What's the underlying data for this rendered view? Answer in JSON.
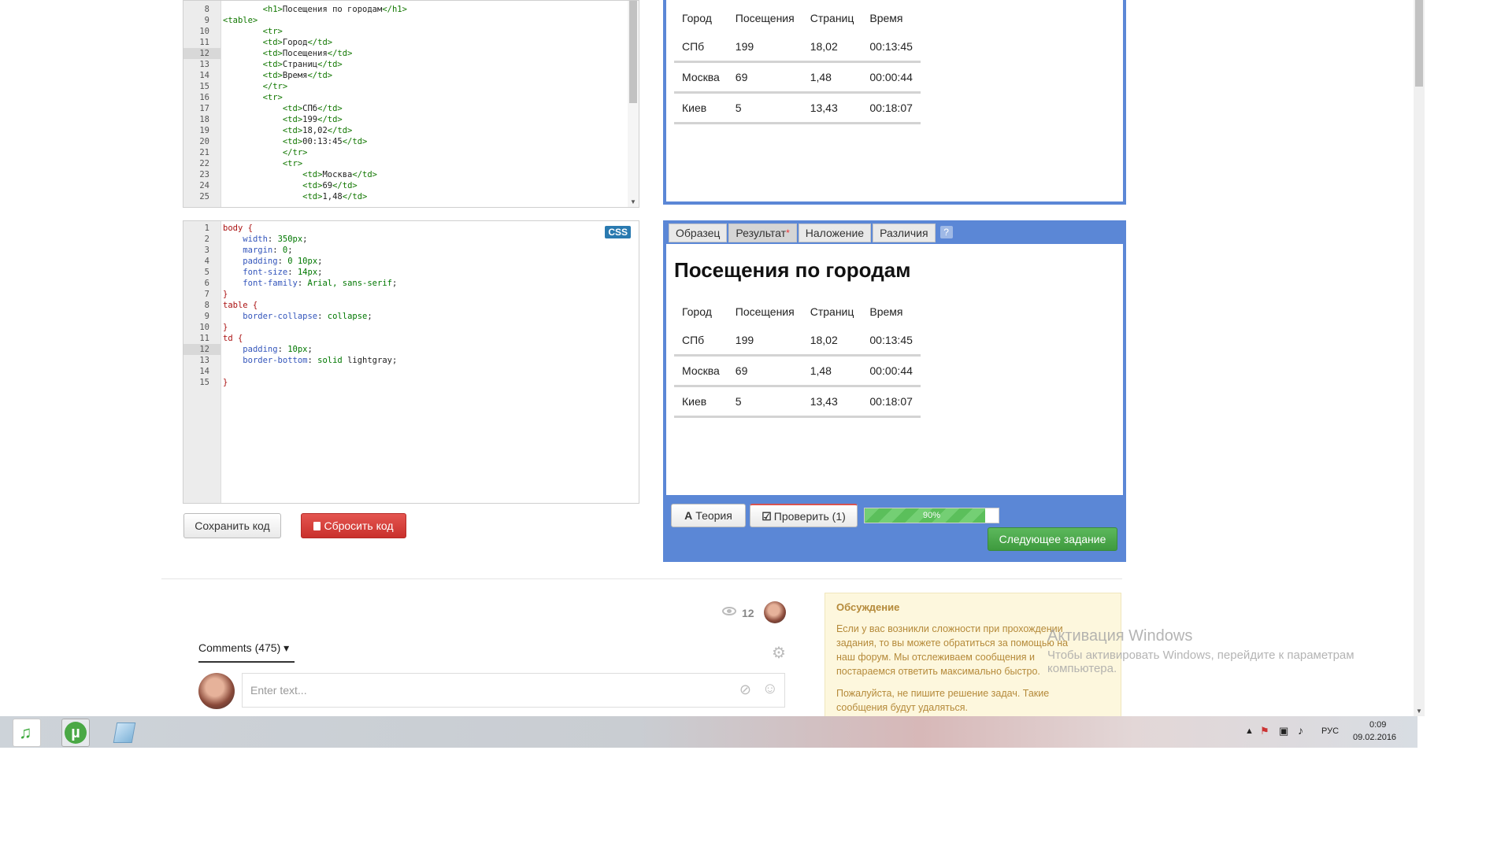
{
  "html_editor": {
    "lines": [
      {
        "n": "8",
        "parts": [
          [
            "pl",
            "        "
          ],
          [
            "tag",
            "<h1>"
          ],
          [
            "pl",
            "Посещения по городам"
          ],
          [
            "tag",
            "</h1>"
          ]
        ]
      },
      {
        "n": "9",
        "parts": [
          [
            "tag",
            "<table>"
          ]
        ]
      },
      {
        "n": "10",
        "parts": [
          [
            "pl",
            "        "
          ],
          [
            "tag",
            "<tr>"
          ]
        ]
      },
      {
        "n": "11",
        "parts": [
          [
            "pl",
            "        "
          ],
          [
            "tag",
            "<td>"
          ],
          [
            "pl",
            "Город"
          ],
          [
            "tag",
            "</td>"
          ]
        ]
      },
      {
        "n": "12",
        "parts": [
          [
            "pl",
            "        "
          ],
          [
            "tag",
            "<td>"
          ],
          [
            "pl",
            "Посещения"
          ],
          [
            "tag",
            "</td>"
          ]
        ],
        "active": true
      },
      {
        "n": "13",
        "parts": [
          [
            "pl",
            "        "
          ],
          [
            "tag",
            "<td>"
          ],
          [
            "pl",
            "Страниц"
          ],
          [
            "tag",
            "</td>"
          ]
        ]
      },
      {
        "n": "14",
        "parts": [
          [
            "pl",
            "        "
          ],
          [
            "tag",
            "<td>"
          ],
          [
            "pl",
            "Время"
          ],
          [
            "tag",
            "</td>"
          ]
        ]
      },
      {
        "n": "15",
        "parts": [
          [
            "pl",
            "        "
          ],
          [
            "tag",
            "</tr>"
          ]
        ]
      },
      {
        "n": "16",
        "parts": [
          [
            "pl",
            "        "
          ],
          [
            "tag",
            "<tr>"
          ]
        ]
      },
      {
        "n": "17",
        "parts": [
          [
            "pl",
            "            "
          ],
          [
            "tag",
            "<td>"
          ],
          [
            "pl",
            "СПб"
          ],
          [
            "tag",
            "</td>"
          ]
        ]
      },
      {
        "n": "18",
        "parts": [
          [
            "pl",
            "            "
          ],
          [
            "tag",
            "<td>"
          ],
          [
            "pl",
            "199"
          ],
          [
            "tag",
            "</td>"
          ]
        ]
      },
      {
        "n": "19",
        "parts": [
          [
            "pl",
            "            "
          ],
          [
            "tag",
            "<td>"
          ],
          [
            "pl",
            "18,02"
          ],
          [
            "tag",
            "</td>"
          ]
        ]
      },
      {
        "n": "20",
        "parts": [
          [
            "pl",
            "            "
          ],
          [
            "tag",
            "<td>"
          ],
          [
            "pl",
            "00:13:45"
          ],
          [
            "tag",
            "</td>"
          ]
        ]
      },
      {
        "n": "21",
        "parts": [
          [
            "pl",
            "            "
          ],
          [
            "tag",
            "</tr>"
          ]
        ]
      },
      {
        "n": "22",
        "parts": [
          [
            "pl",
            "            "
          ],
          [
            "tag",
            "<tr>"
          ]
        ]
      },
      {
        "n": "23",
        "parts": [
          [
            "pl",
            "                "
          ],
          [
            "tag",
            "<td>"
          ],
          [
            "pl",
            "Москва"
          ],
          [
            "tag",
            "</td>"
          ]
        ]
      },
      {
        "n": "24",
        "parts": [
          [
            "pl",
            "                "
          ],
          [
            "tag",
            "<td>"
          ],
          [
            "pl",
            "69"
          ],
          [
            "tag",
            "</td>"
          ]
        ]
      },
      {
        "n": "25",
        "parts": [
          [
            "pl",
            "                "
          ],
          [
            "tag",
            "<td>"
          ],
          [
            "pl",
            "1,48"
          ],
          [
            "tag",
            "</td>"
          ]
        ]
      }
    ]
  },
  "css_editor": {
    "badge": "CSS",
    "lines": [
      {
        "n": "1",
        "parts": [
          [
            "sel",
            "body {"
          ]
        ]
      },
      {
        "n": "2",
        "parts": [
          [
            "pl",
            "    "
          ],
          [
            "prop",
            "width"
          ],
          [
            "pl",
            ": "
          ],
          [
            "val",
            "350px"
          ],
          [
            "pl",
            ";"
          ]
        ]
      },
      {
        "n": "3",
        "parts": [
          [
            "pl",
            "    "
          ],
          [
            "prop",
            "margin"
          ],
          [
            "pl",
            ": "
          ],
          [
            "val",
            "0"
          ],
          [
            "pl",
            ";"
          ]
        ]
      },
      {
        "n": "4",
        "parts": [
          [
            "pl",
            "    "
          ],
          [
            "prop",
            "padding"
          ],
          [
            "pl",
            ": "
          ],
          [
            "val",
            "0 10px"
          ],
          [
            "pl",
            ";"
          ]
        ]
      },
      {
        "n": "5",
        "parts": [
          [
            "pl",
            "    "
          ],
          [
            "prop",
            "font-size"
          ],
          [
            "pl",
            ": "
          ],
          [
            "val",
            "14px"
          ],
          [
            "pl",
            ";"
          ]
        ]
      },
      {
        "n": "6",
        "parts": [
          [
            "pl",
            "    "
          ],
          [
            "prop",
            "font-family"
          ],
          [
            "pl",
            ": "
          ],
          [
            "val",
            "Arial, sans-serif"
          ],
          [
            "pl",
            ";"
          ]
        ]
      },
      {
        "n": "7",
        "parts": [
          [
            "sel",
            "}"
          ]
        ]
      },
      {
        "n": "8",
        "parts": [
          [
            "sel",
            "table {"
          ]
        ]
      },
      {
        "n": "9",
        "parts": [
          [
            "pl",
            "    "
          ],
          [
            "prop",
            "border-collapse"
          ],
          [
            "pl",
            ": "
          ],
          [
            "val",
            "collapse"
          ],
          [
            "pl",
            ";"
          ]
        ]
      },
      {
        "n": "10",
        "parts": [
          [
            "sel",
            "}"
          ]
        ]
      },
      {
        "n": "11",
        "parts": [
          [
            "sel",
            "td {"
          ]
        ]
      },
      {
        "n": "12",
        "parts": [
          [
            "pl",
            "    "
          ],
          [
            "prop",
            "padding"
          ],
          [
            "pl",
            ": "
          ],
          [
            "val",
            "10px"
          ],
          [
            "pl",
            ";"
          ]
        ],
        "active": true
      },
      {
        "n": "13",
        "parts": [
          [
            "pl",
            "    "
          ],
          [
            "prop",
            "border-bottom"
          ],
          [
            "pl",
            ": "
          ],
          [
            "val",
            "solid "
          ],
          [
            "pl",
            "lightgray;"
          ]
        ]
      },
      {
        "n": "14",
        "parts": []
      },
      {
        "n": "15",
        "parts": [
          [
            "sel",
            "}"
          ]
        ]
      }
    ]
  },
  "buttons": {
    "save": "Сохранить код",
    "reset": "Сбросить код",
    "theory": "Теория",
    "check": "Проверить (1)",
    "next": "Следующее задание"
  },
  "table": {
    "rows": [
      [
        "Город",
        "Посещения",
        "Страниц",
        "Время"
      ],
      [
        "СПб",
        "199",
        "18,02",
        "00:13:45"
      ],
      [
        "Москва",
        "69",
        "1,48",
        "00:00:44"
      ],
      [
        "Киев",
        "5",
        "13,43",
        "00:18:07"
      ]
    ]
  },
  "result": {
    "heading": "Посещения по городам",
    "tabs": [
      "Образец",
      "Результат",
      "Наложение",
      "Различия"
    ],
    "help": "?"
  },
  "progress": {
    "value": 0.9,
    "label": "90%"
  },
  "comments": {
    "views": "12",
    "tab_label": "Comments (475) ▾",
    "placeholder": "Enter text..."
  },
  "discussion": {
    "title": "Обсуждение",
    "p1": "Если у вас возникли сложности при прохождении задания, то вы можете обратиться за помощью на наш форум. Мы отслеживаем сообщения и постараемся ответить максимально быстро.",
    "p2": "Пожалуйста, не пишите решение задач. Такие сообщения будут удаляться."
  },
  "watermark": {
    "title": "Активация Windows",
    "text": "Чтобы активировать Windows, перейдите к параметрам компьютера."
  },
  "tray": {
    "lang": "РУС",
    "time": "0:09",
    "date": "09.02.2016"
  },
  "colors": {
    "accent_blue": "#5b87d6",
    "reset_red": "#d9534f",
    "next_green": "#4cae4c",
    "progress_green": "#5bbf5b"
  }
}
